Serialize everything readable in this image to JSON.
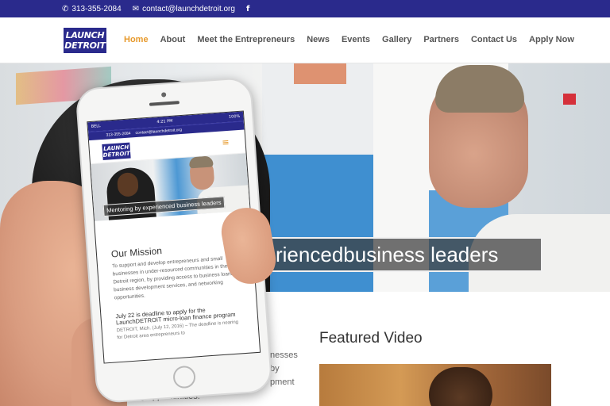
{
  "topbar": {
    "phone": "313-355-2084",
    "email": "contact@launchdetroit.org",
    "facebook": "f"
  },
  "brand": {
    "logo_line1": "LAUNCH",
    "logo_line2": "DETROIT",
    "primary_color": "#2a2a8c",
    "accent_color": "#e79a2c"
  },
  "nav": {
    "items": [
      {
        "label": "Home",
        "active": true
      },
      {
        "label": "About"
      },
      {
        "label": "Meet the Entrepreneurs"
      },
      {
        "label": "News"
      },
      {
        "label": "Events"
      },
      {
        "label": "Gallery"
      },
      {
        "label": "Partners"
      },
      {
        "label": "Contact Us"
      },
      {
        "label": "Apply Now"
      }
    ]
  },
  "hero": {
    "caption": "riencedbusiness leaders"
  },
  "main": {
    "featured_video_title": "Featured Video",
    "partial_text_lines": [
      "nesses",
      "by",
      "pment"
    ],
    "partial_text_bottom": "ing opportunities."
  },
  "phone_screen": {
    "status": {
      "carrier": "BELL",
      "time": "4:21 PM",
      "battery": "100%"
    },
    "topbar_phone": "313-355-2084",
    "topbar_email": "contact@launchdetroit.org",
    "menu_icon": "hamburger-icon",
    "hero_caption": "Mentoring by experienced business leaders",
    "mission_title": "Our Mission",
    "mission_text": "To support and develop entrepreneurs and small businesses in under-resourced communities in the Detroit region, by providing access to business loans, business development services, and networking opportunities.",
    "news_title": "July 22 is deadline to apply for the LaunchDETROIT micro-loan finance program",
    "news_text": "DETROIT, Mich. (July 12, 2016) – The deadline is nearing for Detroit area entrepreneurs to"
  }
}
